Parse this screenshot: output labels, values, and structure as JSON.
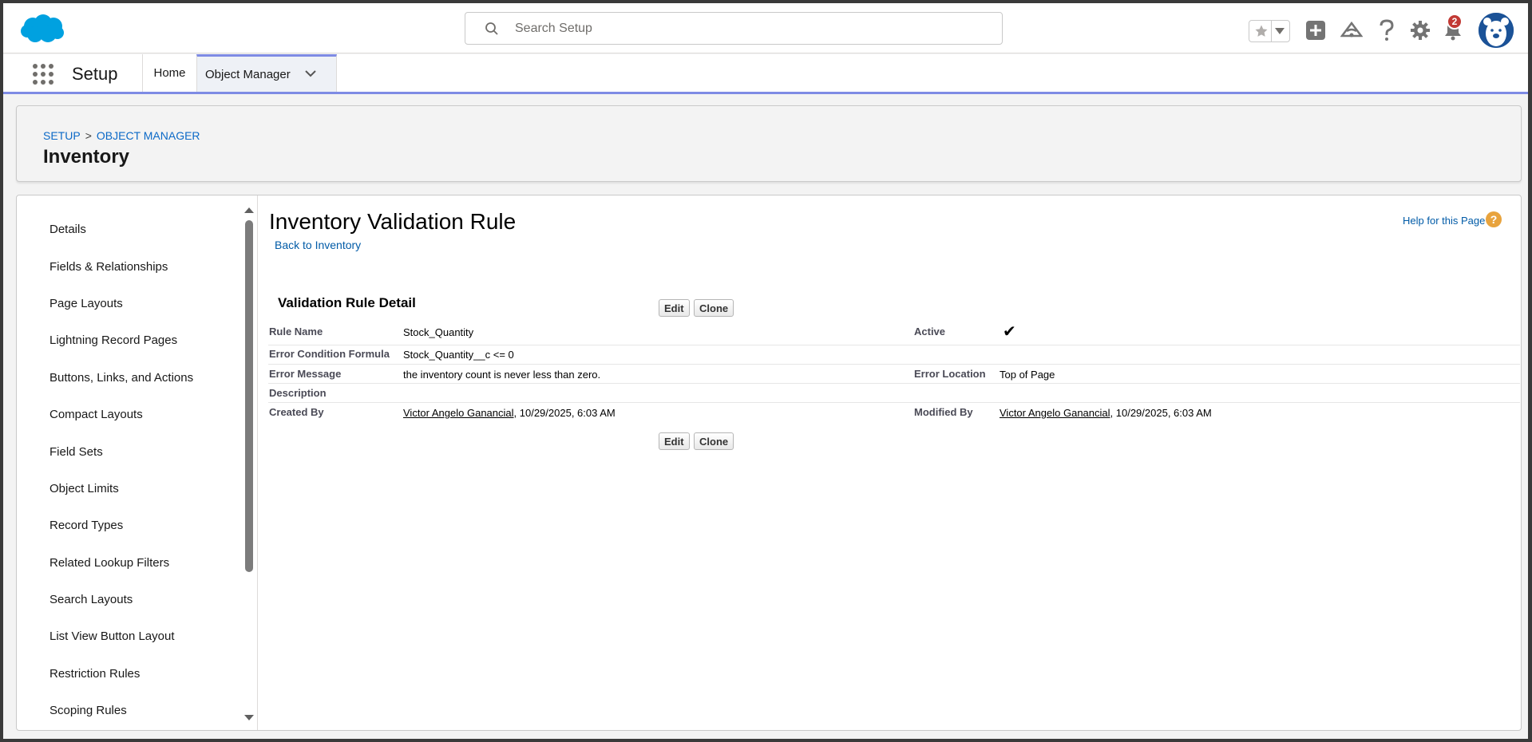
{
  "header": {
    "search_placeholder": "Search Setup",
    "notification_count": "2",
    "brand_color": "#00a1e0"
  },
  "nav": {
    "app_name": "Setup",
    "tabs": [
      {
        "label": "Home"
      },
      {
        "label": "Object Manager"
      }
    ],
    "accent_color": "#7e8be4"
  },
  "page_header": {
    "breadcrumb": [
      "SETUP",
      "OBJECT MANAGER"
    ],
    "breadcrumb_separator": ">",
    "title": "Inventory"
  },
  "sidebar": {
    "items": [
      {
        "label": "Details"
      },
      {
        "label": "Fields & Relationships"
      },
      {
        "label": "Page Layouts"
      },
      {
        "label": "Lightning Record Pages"
      },
      {
        "label": "Buttons, Links, and Actions"
      },
      {
        "label": "Compact Layouts"
      },
      {
        "label": "Field Sets"
      },
      {
        "label": "Object Limits"
      },
      {
        "label": "Record Types"
      },
      {
        "label": "Related Lookup Filters"
      },
      {
        "label": "Search Layouts"
      },
      {
        "label": "List View Button Layout"
      },
      {
        "label": "Restriction Rules"
      },
      {
        "label": "Scoping Rules"
      }
    ]
  },
  "detail": {
    "title": "Inventory Validation Rule",
    "back_link": "Back to Inventory",
    "help_link": "Help for this Page",
    "help_icon": "?",
    "section_title": "Validation Rule Detail",
    "edit_label": "Edit",
    "clone_label": "Clone",
    "fields": {
      "rule_name_label": "Rule Name",
      "rule_name": "Stock_Quantity",
      "active_label": "Active",
      "active_check": "✔",
      "formula_label": "Error Condition Formula",
      "formula": "Stock_Quantity__c <= 0",
      "error_message_label": "Error Message",
      "error_message": "the inventory count is never less than zero.",
      "error_location_label": "Error Location",
      "error_location": "Top of Page",
      "description_label": "Description",
      "description": "",
      "created_by_label": "Created By",
      "created_by_user": "Victor Angelo Ganancial",
      "created_by_date": ", 10/29/2025, 6:03 AM",
      "modified_by_label": "Modified By",
      "modified_by_user": "Victor Angelo Ganancial",
      "modified_by_date": ", 10/29/2025, 6:03 AM"
    }
  }
}
